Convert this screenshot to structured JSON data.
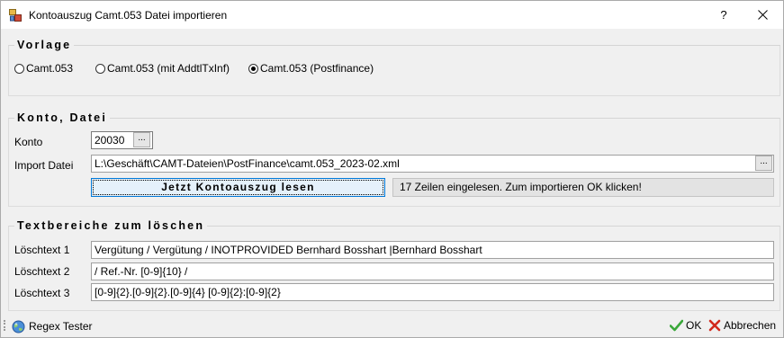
{
  "window": {
    "title": "Kontoauszug Camt.053 Datei importieren",
    "help_label": "?"
  },
  "vorlage": {
    "title": "Vorlage",
    "options": [
      {
        "label": "Camt.053",
        "checked": false
      },
      {
        "label": "Camt.053 (mit AddtlTxInf)",
        "checked": false
      },
      {
        "label": "Camt.053 (Postfinance)",
        "checked": true
      }
    ]
  },
  "konto_datei": {
    "title": "Konto, Datei",
    "konto_label": "Konto",
    "konto_value": "20030",
    "browse_label": "...",
    "import_label": "Import Datei",
    "import_value": "L:\\Geschäft\\CAMT-Dateien\\PostFinance\\camt.053_2023-02.xml",
    "read_button": "Jetzt Kontoauszug lesen",
    "status_text": "17 Zeilen eingelesen. Zum importieren OK klicken!"
  },
  "textbereiche": {
    "title": "Textbereiche zum löschen",
    "rows": [
      {
        "label": "Löschtext 1",
        "value": "Vergütung / Vergütung / INOTPROVIDED Bernhard Bosshart |Bernhard Bosshart"
      },
      {
        "label": "Löschtext 2",
        "value": "/ Ref.-Nr. [0-9]{10} /"
      },
      {
        "label": "Löschtext 3",
        "value": "[0-9]{2}.[0-9]{2}.[0-9]{4} [0-9]{2}:[0-9]{2}"
      }
    ]
  },
  "footer": {
    "regex_label": "Regex Tester",
    "ok_label": "OK",
    "cancel_label": "Abbrechen"
  }
}
